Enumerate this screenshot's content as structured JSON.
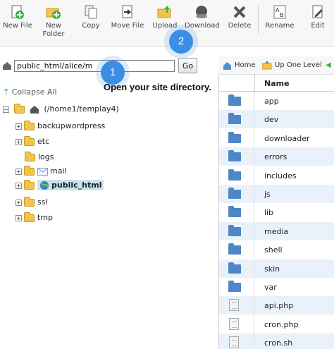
{
  "toolbar": {
    "new_file": "New File",
    "new_folder_line1": "New",
    "new_folder_line2": "Folder",
    "copy": "Copy",
    "move_file": "Move File",
    "upload": "Upload",
    "download": "Download",
    "delete": "Delete",
    "rename": "Rename",
    "edit": "Edit"
  },
  "pathbar": {
    "value": "public_html/alice/m",
    "go": "Go"
  },
  "hint": "Open your site directory.",
  "badges": {
    "one": "1",
    "two": "2"
  },
  "tree": {
    "collapse_all": "Collapse All",
    "root": "(/home1/templay4)",
    "items": [
      {
        "label": "backupwordpress"
      },
      {
        "label": "etc"
      },
      {
        "label": "logs"
      },
      {
        "label": "mail"
      },
      {
        "label": "public_html"
      },
      {
        "label": "ssl"
      },
      {
        "label": "tmp"
      }
    ]
  },
  "rightbar": {
    "home": "Home",
    "up": "Up One Level"
  },
  "list": {
    "header": "Name",
    "rows": [
      {
        "name": "app",
        "type": "folder"
      },
      {
        "name": "dev",
        "type": "folder"
      },
      {
        "name": "downloader",
        "type": "folder"
      },
      {
        "name": "errors",
        "type": "folder"
      },
      {
        "name": "includes",
        "type": "folder"
      },
      {
        "name": "js",
        "type": "folder"
      },
      {
        "name": "lib",
        "type": "folder"
      },
      {
        "name": "media",
        "type": "folder"
      },
      {
        "name": "shell",
        "type": "folder"
      },
      {
        "name": "skin",
        "type": "folder"
      },
      {
        "name": "var",
        "type": "folder"
      },
      {
        "name": "api.php",
        "type": "file"
      },
      {
        "name": "cron.php",
        "type": "file"
      },
      {
        "name": "cron.sh",
        "type": "file"
      }
    ]
  },
  "colors": {
    "accent": "#3a8ee6",
    "selected": "#c7e3ec",
    "folder": "#f2c54a",
    "list_folder": "#4f86c6"
  }
}
